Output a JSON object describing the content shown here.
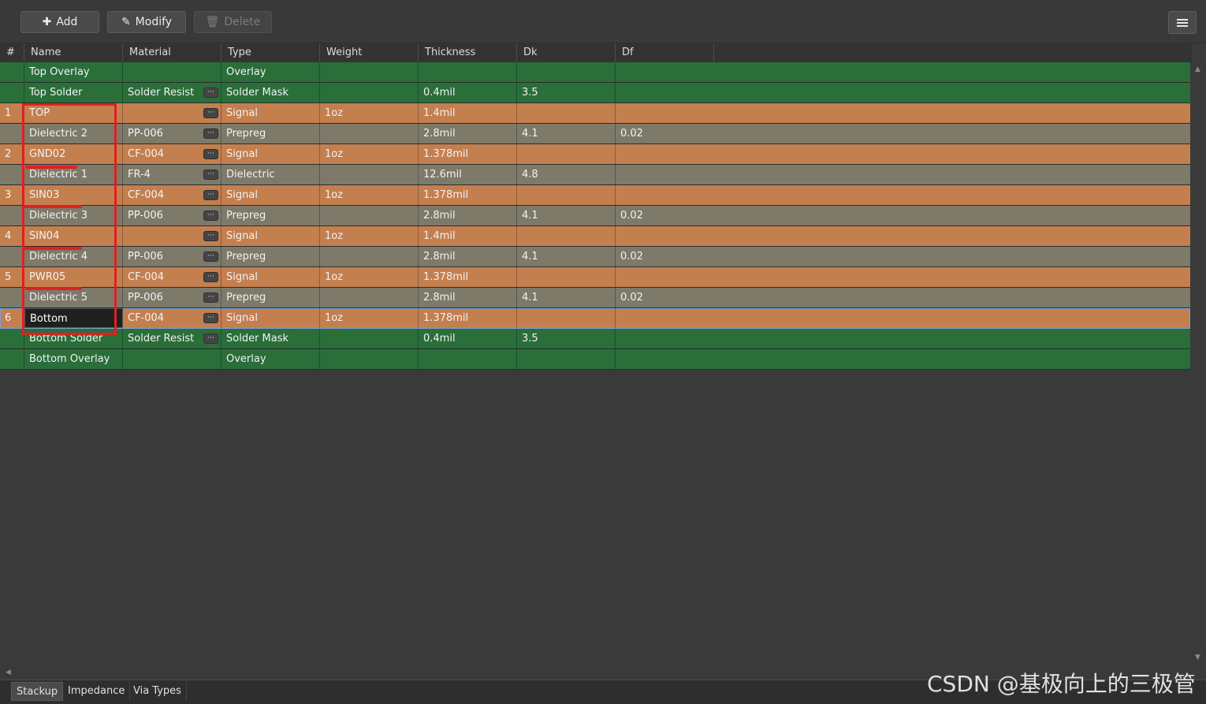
{
  "toolbar": {
    "add_label": "Add",
    "modify_label": "Modify",
    "delete_label": "Delete"
  },
  "columns": [
    "#",
    "Name",
    "Material",
    "Type",
    "Weight",
    "Thickness",
    "Dk",
    "Df"
  ],
  "rows": [
    {
      "color": "green",
      "num": "",
      "name": "Top Overlay",
      "material": "",
      "dots": false,
      "type": "Overlay",
      "weight": "",
      "thickness": "",
      "dk": "",
      "df": ""
    },
    {
      "color": "green",
      "num": "",
      "name": "Top Solder",
      "material": "Solder Resist",
      "dots": true,
      "type": "Solder Mask",
      "weight": "",
      "thickness": "0.4mil",
      "dk": "3.5",
      "df": ""
    },
    {
      "color": "orange",
      "num": "1",
      "name": "TOP",
      "material": "",
      "dots": true,
      "type": "Signal",
      "weight": "1oz",
      "thickness": "1.4mil",
      "dk": "",
      "df": ""
    },
    {
      "color": "gray",
      "num": "",
      "name": "Dielectric 2",
      "material": "PP-006",
      "dots": true,
      "type": "Prepreg",
      "weight": "",
      "thickness": "2.8mil",
      "dk": "4.1",
      "df": "0.02"
    },
    {
      "color": "orange",
      "num": "2",
      "name": "GND02",
      "material": "CF-004",
      "dots": true,
      "type": "Signal",
      "weight": "1oz",
      "thickness": "1.378mil",
      "dk": "",
      "df": ""
    },
    {
      "color": "gray",
      "num": "",
      "name": "Dielectric 1",
      "material": "FR-4",
      "dots": true,
      "type": "Dielectric",
      "weight": "",
      "thickness": "12.6mil",
      "dk": "4.8",
      "df": ""
    },
    {
      "color": "orange",
      "num": "3",
      "name": "SIN03",
      "material": "CF-004",
      "dots": true,
      "type": "Signal",
      "weight": "1oz",
      "thickness": "1.378mil",
      "dk": "",
      "df": ""
    },
    {
      "color": "gray",
      "num": "",
      "name": "Dielectric 3",
      "material": "PP-006",
      "dots": true,
      "type": "Prepreg",
      "weight": "",
      "thickness": "2.8mil",
      "dk": "4.1",
      "df": "0.02"
    },
    {
      "color": "orange",
      "num": "4",
      "name": "SIN04",
      "material": "",
      "dots": true,
      "type": "Signal",
      "weight": "1oz",
      "thickness": "1.4mil",
      "dk": "",
      "df": ""
    },
    {
      "color": "gray",
      "num": "",
      "name": "Dielectric 4",
      "material": "PP-006",
      "dots": true,
      "type": "Prepreg",
      "weight": "",
      "thickness": "2.8mil",
      "dk": "4.1",
      "df": "0.02"
    },
    {
      "color": "orange",
      "num": "5",
      "name": "PWR05",
      "material": "CF-004",
      "dots": true,
      "type": "Signal",
      "weight": "1oz",
      "thickness": "1.378mil",
      "dk": "",
      "df": ""
    },
    {
      "color": "gray",
      "num": "",
      "name": "Dielectric 5",
      "material": "PP-006",
      "dots": true,
      "type": "Prepreg",
      "weight": "",
      "thickness": "2.8mil",
      "dk": "4.1",
      "df": "0.02"
    },
    {
      "color": "orange",
      "num": "6",
      "name": "Bottom",
      "material": "CF-004",
      "dots": true,
      "type": "Signal",
      "weight": "1oz",
      "thickness": "1.378mil",
      "dk": "",
      "df": "",
      "selected": true
    },
    {
      "color": "green",
      "num": "",
      "name": "Bottom Solder",
      "material": "Solder Resist",
      "dots": true,
      "type": "Solder Mask",
      "weight": "",
      "thickness": "0.4mil",
      "dk": "3.5",
      "df": ""
    },
    {
      "color": "green",
      "num": "",
      "name": "Bottom Overlay",
      "material": "",
      "dots": false,
      "type": "Overlay",
      "weight": "",
      "thickness": "",
      "dk": "",
      "df": ""
    }
  ],
  "tabs": [
    "Stackup",
    "Impedance",
    "Via Types"
  ],
  "watermark": "CSDN @基极向上的三极管",
  "colors": {
    "overlay_green": "#2a6e3a",
    "signal_orange": "#c47f4f",
    "dielectric_gray": "#7d7a6a",
    "annotation_red": "#e02020"
  }
}
